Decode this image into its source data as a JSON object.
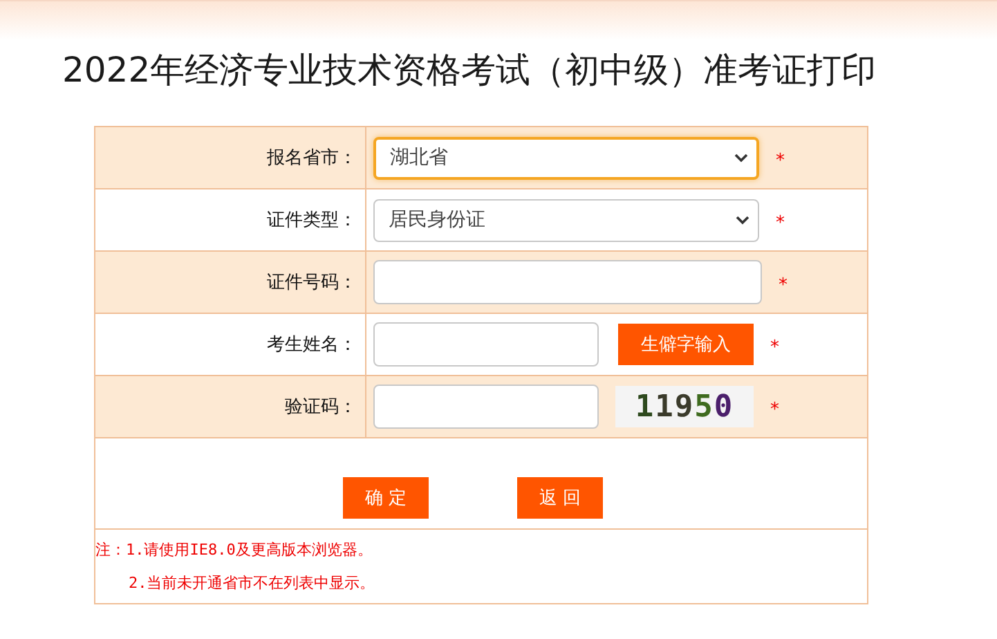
{
  "title": "2022年经济专业技术资格考试（初中级）准考证打印",
  "fields": [
    {
      "label": "报名省市：",
      "kind": "select",
      "value": "湖北省",
      "focused": true,
      "required_mark": "*"
    },
    {
      "label": "证件类型：",
      "kind": "select",
      "value": "居民身份证",
      "focused": false,
      "required_mark": "*"
    },
    {
      "label": "证件号码：",
      "kind": "input",
      "focused": false,
      "required_mark": "*"
    },
    {
      "label": "考生姓名：",
      "kind": "input_button",
      "focused": false,
      "button": "生僻字输入",
      "required_mark": "*"
    },
    {
      "label": "验证码：",
      "kind": "input_captcha",
      "focused": false,
      "captcha": "11950",
      "required_mark": "*"
    }
  ],
  "buttons": [
    "确 定",
    "返 回"
  ],
  "notes": [
    "注：1.请使用IE8.0及更高版本浏览器。",
    "2.当前未开通省市不在列表中显示。"
  ]
}
